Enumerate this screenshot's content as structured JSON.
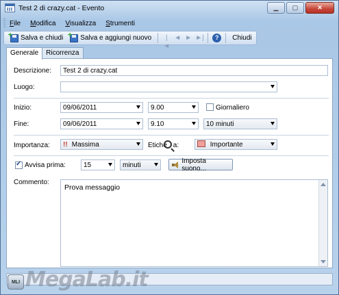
{
  "window": {
    "title": "Test 2 di crazy.cat - Evento",
    "minimize_icon": "minimize-icon",
    "maximize_icon": "maximize-icon",
    "close_icon": "close-icon"
  },
  "menu": {
    "items": [
      {
        "label": "File",
        "accel": "F"
      },
      {
        "label": "Modifica",
        "accel": "M"
      },
      {
        "label": "Visualizza",
        "accel": "V"
      },
      {
        "label": "Strumenti",
        "accel": "S"
      }
    ]
  },
  "toolbar": {
    "save_close": "Salva e chiudi",
    "save_add": "Salva e aggiungi nuovo",
    "close": "Chiudi",
    "help_glyph": "?"
  },
  "tabs": [
    {
      "label": "Generale",
      "active": true
    },
    {
      "label": "Ricorrenza",
      "active": false
    }
  ],
  "form": {
    "descrizione_label": "Descrizione:",
    "descrizione_value": "Test 2 di crazy.cat",
    "luogo_label": "Luogo:",
    "luogo_value": "",
    "inizio_label": "Inizio:",
    "inizio_date": "09/06/2011",
    "inizio_time": "9.00",
    "giornaliero_label": "Giornaliero",
    "giornaliero_checked": false,
    "fine_label": "Fine:",
    "fine_date": "09/06/2011",
    "fine_time": "9.10",
    "duration": "10 minuti",
    "importanza_label": "Importanza:",
    "importanza_value": "Massima",
    "importanza_glyph": "!!",
    "etichetta_label": "Etiche",
    "etichetta_label_tail": "a:",
    "etichetta_value": "Importante",
    "etichetta_color": "#f0a09a",
    "avvisa_label": "Avvisa prima:",
    "avvisa_checked": true,
    "avvisa_value": "15",
    "avvisa_unit": "minuti",
    "sound_button": "Imposta suono...",
    "commento_label": "Commento:",
    "commento_value": "Prova messaggio"
  },
  "watermark": {
    "logo_text": "MLI",
    "brand_text": "MegaLab.it"
  }
}
